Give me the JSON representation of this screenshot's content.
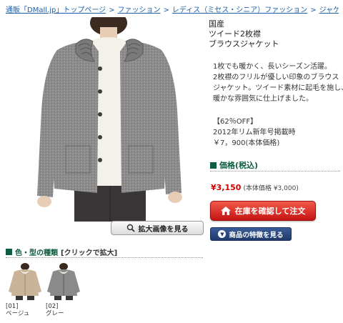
{
  "breadcrumb": [
    "通販「DMall.jp」トップページ",
    "ファッション",
    "レディス（ミセス・シニア）ファッション",
    "ジャケット"
  ],
  "breadcrumb_separator": ">",
  "product": {
    "title_lines": [
      "国産",
      "ツイード2枚襟",
      "ブラウスジャケット"
    ],
    "description_lines": [
      "1枚でも暖かく、長いシーズン活躍。",
      "2枚襟のフリルが優しい印象のブラウス",
      "ジャケット。ツイード素材に起毛を施し、",
      "暖かな雰囲気に仕上げました。"
    ],
    "promo_lines": [
      "【62％OFF】",
      "2012年リム新年号掲載時",
      "￥7，900(本体価格)"
    ]
  },
  "zoom_button": "拡大画像を見る",
  "price_section": {
    "heading": "価格(税込)",
    "price": "¥3,150",
    "base_price": "(本体価格 ¥3,000)"
  },
  "cart_button": "在庫を確認して注文",
  "feature_button": "商品の特徴を見る",
  "color_section": {
    "heading": "色・型の種類",
    "hint": "[クリックで拡大]",
    "options": [
      {
        "code": "[01]",
        "name": "ベージュ"
      },
      {
        "code": "[02]",
        "name": "グレー"
      }
    ]
  },
  "colors": {
    "link": "#1a5fa8",
    "heading_green": "#0d5e3e",
    "price_red": "#d40000",
    "cart_red": "#c51414",
    "feature_navy": "#203a6c",
    "jacket_gray": "#8a8a8a",
    "beige": "#c9b49a"
  }
}
